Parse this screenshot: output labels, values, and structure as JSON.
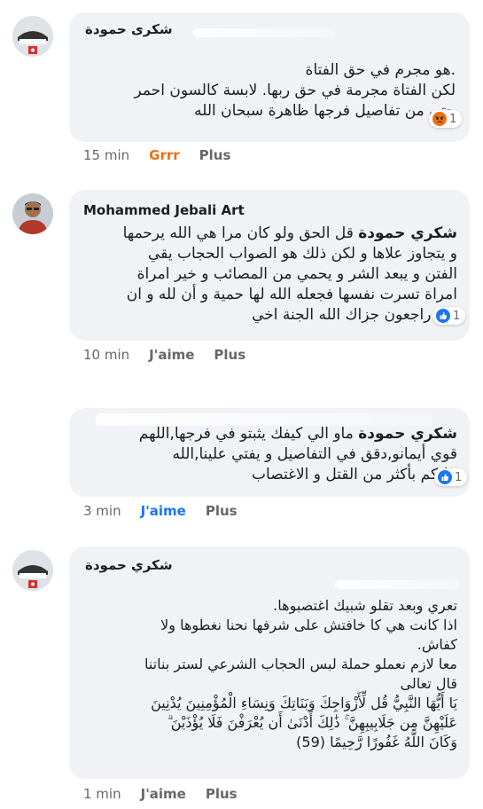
{
  "comments": [
    {
      "author": "شكرى حمودة",
      "text": ".هو مجرم في حق الفتاة\nلكن الفتاة مجرمة في حق ربها. لابسة كالسون احمر\nحتى من تفاصيل فرجها ظاهرة سبحان الله",
      "reaction_count": "1",
      "reaction_icon": "angry-face-icon",
      "time": "15 min",
      "action": "Grrr",
      "more": "Plus"
    },
    {
      "author": "Mohammed Jebali Art",
      "mention": "شكري حمودة",
      "text": " قل الحق ولو كان مرا هي الله يرحمها\nو يتجاوز علاها و لكن ذلك هو الصواب الحجاب يقي\nالفتن و يبعد الشر و يحمي من المصائب و خير امراة\nامراة تسرت نفسها فجعله الله لها حمية و أن لله و ان\nاليه راجعون جزاك الله الجنة اخي",
      "reaction_count": "1",
      "reaction_icon": "like-thumb-icon",
      "time": "10 min",
      "action": "J'aime",
      "more": "Plus"
    },
    {
      "author": "",
      "mention": "شكري حمودة",
      "text": " ماو الي كيفك يثبتو في فرجها,اللهم\nقوي أيمانو,دقق في التفاصيل و يفتي علينا,الله\nيبليكم بأكثر من القتل و الاغتصاب",
      "reaction_count": "1",
      "reaction_icon": "like-thumb-icon",
      "time": "3 min",
      "action": "J'aime",
      "more": "Plus"
    },
    {
      "author": "شكري حمودة",
      "text": "تعري وبعد تقلو شبيك اغتصبوها.\nاذا كانت هي كا خافتش على شرفها نحنا نغطوها ولا\nكفاش.\nمعا لازم نعملو حملة لبس الحجاب الشرعي لستر بناتنا\nقال تعالى\nيَا أَيُّهَا النَّبِيُّ قُل لِّأَزْوَاجِكَ وَبَنَاتِكَ وَنِسَاءِ الْمُؤْمِنِينَ يُدْنِينَ\nعَلَيْهِنَّ مِن جَلَابِيبِهِنَّ ۚ ذَٰلِكَ أَدْنَىٰ أَن يُعْرَفْنَ فَلَا يُؤْذَيْنَ ۗ\nوَكَانَ اللَّهُ غَفُورًا رَّحِيمًا (59)",
      "time": "1 min",
      "action": "J'aime",
      "more": "Plus"
    }
  ]
}
